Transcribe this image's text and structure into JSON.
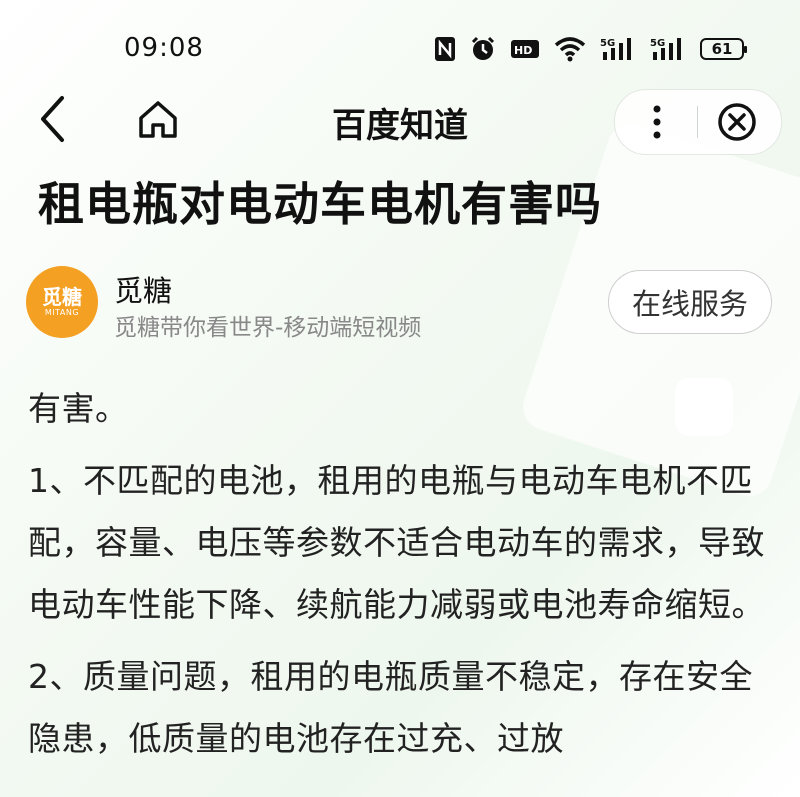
{
  "status_bar": {
    "time": "09:08",
    "icons": [
      "nfc-icon",
      "alarm-icon",
      "hd-icon",
      "wifi-icon",
      "5g-signal-icon",
      "5g-signal-icon"
    ],
    "signal_label_1": "5G",
    "signal_label_2": "5G",
    "battery": "61"
  },
  "nav": {
    "title": "百度知道"
  },
  "article": {
    "title": "租电瓶对电动车电机有害吗"
  },
  "author": {
    "avatar_text": "觅糖",
    "avatar_subtext": "MITANG",
    "name": "觅糖",
    "description": "觅糖带你看世界-移动端短视频",
    "service_button": "在线服务",
    "avatar_color": "#f4a023"
  },
  "content": {
    "paragraphs": [
      "有害。",
      "1、不匹配的电池，租用的电瓶与电动车电机不匹配，容量、电压等参数不适合电动车的需求，导致电动车性能下降、续航能力减弱或电池寿命缩短。",
      "2、质量问题，租用的电瓶质量不稳定，存在安全隐患，低质量的电池存在过充、过放"
    ]
  }
}
